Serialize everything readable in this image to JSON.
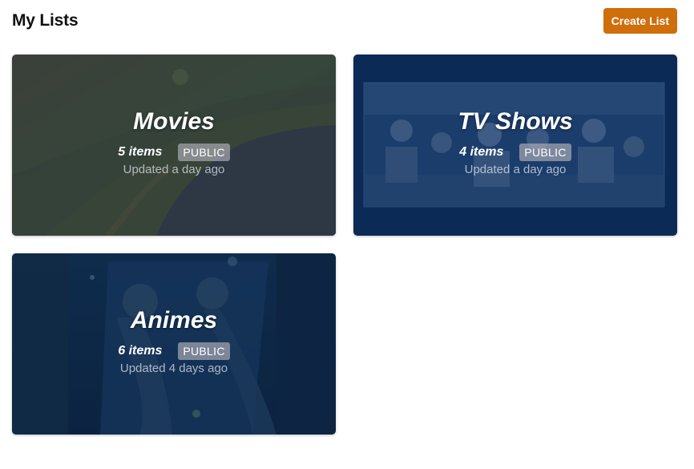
{
  "header": {
    "title": "My Lists",
    "create_label": "Create List"
  },
  "lists": [
    {
      "title": "Movies",
      "count": "5 items",
      "visibility": "PUBLIC",
      "updated": "Updated a day ago"
    },
    {
      "title": "TV Shows",
      "count": "4 items",
      "visibility": "PUBLIC",
      "updated": "Updated a day ago"
    },
    {
      "title": "Animes",
      "count": "6 items",
      "visibility": "PUBLIC",
      "updated": "Updated 4 days ago"
    }
  ],
  "colors": {
    "accent": "#cf6e0b",
    "movies_bg": "#2f3a36",
    "tvshows_bg": "#0b2a55",
    "animes_bg": "#0d2746"
  }
}
